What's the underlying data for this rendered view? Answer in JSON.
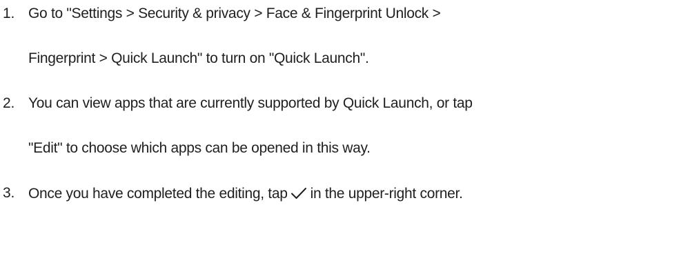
{
  "steps": [
    {
      "number": "1.",
      "lines": [
        "Go to \"Settings > Security & privacy > Face & Fingerprint Unlock >",
        "Fingerprint > Quick Launch\" to turn on \"Quick Launch\"."
      ]
    },
    {
      "number": "2.",
      "lines": [
        "You can view apps that are currently supported by Quick Launch, or tap",
        "\"Edit\" to choose which apps can be opened in this way."
      ]
    },
    {
      "number": "3.",
      "before_icon": "Once you have completed the editing, tap",
      "icon": "checkmark-icon",
      "after_icon": "in the upper-right corner."
    }
  ]
}
